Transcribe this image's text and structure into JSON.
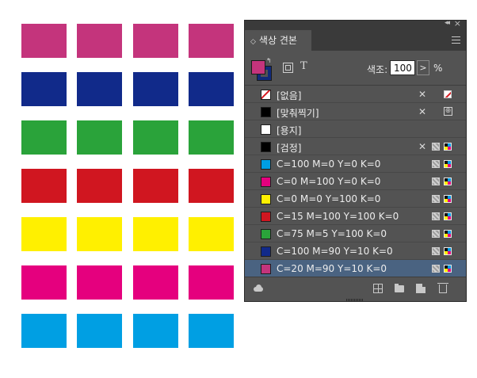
{
  "panel": {
    "tab_label": "색상 견본",
    "tab_chevron": "◇",
    "collapse_icon": "◂◂",
    "close_icon": "×",
    "tint_label": "색조:",
    "tint_value": "100",
    "tint_arrow": ">",
    "tint_unit": "%",
    "text_toggle": "T",
    "swap_icon": "↰",
    "fill_color": "#c4347c",
    "stroke_color": "#112a7a"
  },
  "swatches": [
    {
      "name": "[없음]",
      "color": "none",
      "icons": [
        "lock",
        "none"
      ]
    },
    {
      "name": "[맞춰찍기]",
      "color": "#000000",
      "icons": [
        "lock",
        "registration"
      ]
    },
    {
      "name": "[용지]",
      "color": "#ffffff",
      "icons": []
    },
    {
      "name": "[검정]",
      "color": "#000000",
      "icons": [
        "lock",
        "process",
        "cmyk"
      ]
    },
    {
      "name": "C=100 M=0 Y=0 K=0",
      "color": "#009fe3",
      "icons": [
        "process",
        "cmyk"
      ]
    },
    {
      "name": "C=0 M=100 Y=0 K=0",
      "color": "#e5007e",
      "icons": [
        "process",
        "cmyk"
      ]
    },
    {
      "name": "C=0 M=0 Y=100 K=0",
      "color": "#fff000",
      "icons": [
        "process",
        "cmyk"
      ]
    },
    {
      "name": "C=15 M=100 Y=100 K=0",
      "color": "#d01620",
      "icons": [
        "process",
        "cmyk"
      ]
    },
    {
      "name": "C=75 M=5 Y=100 K=0",
      "color": "#2aa33a",
      "icons": [
        "process",
        "cmyk"
      ]
    },
    {
      "name": "C=100 M=90 Y=10 K=0",
      "color": "#112a8a",
      "icons": [
        "process",
        "cmyk"
      ]
    },
    {
      "name": "C=20 M=90 Y=10 K=0",
      "color": "#c4347c",
      "icons": [
        "process",
        "cmyk"
      ],
      "selected": true
    }
  ],
  "page_grid": {
    "rows": [
      "#c4347c",
      "#112a8a",
      "#2aa33a",
      "#d01620",
      "#fff000",
      "#e5007e",
      "#009fe3"
    ],
    "columns": 4
  },
  "icons": {
    "lock": "pencil-slash-icon",
    "none": "none-swatch-icon",
    "registration": "registration-icon",
    "process": "process-color-icon",
    "cmyk": "cmyk-icon"
  }
}
